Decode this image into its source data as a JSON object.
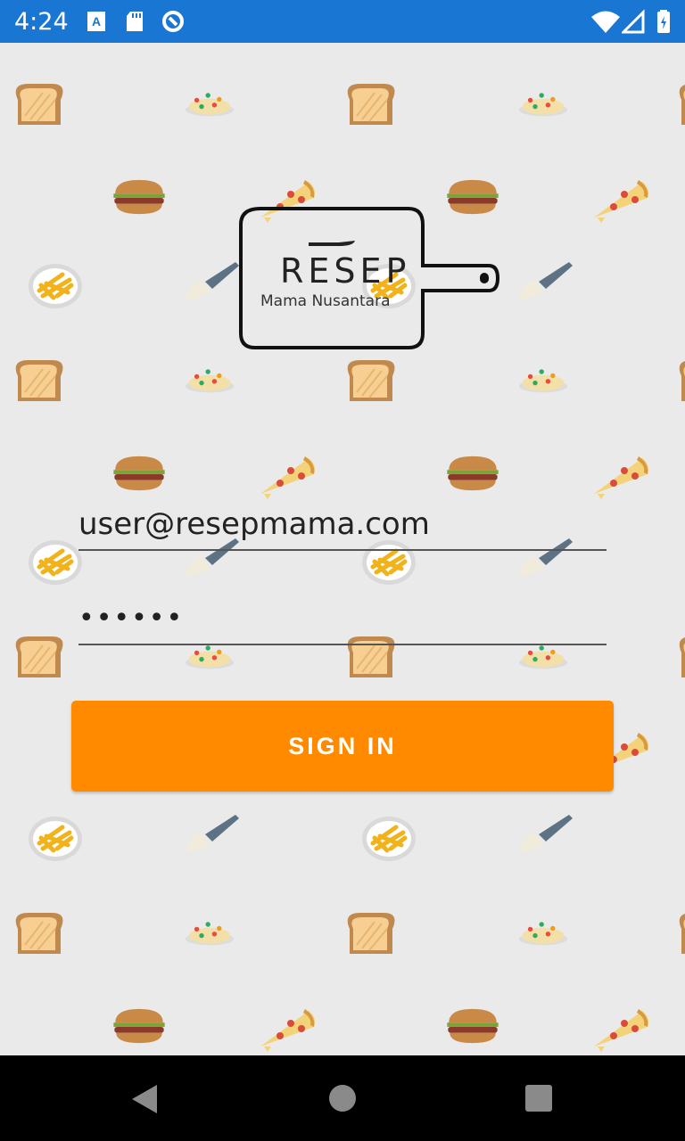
{
  "status_bar": {
    "time": "4:24"
  },
  "logo": {
    "title": "RESEP",
    "subtitle": "Mama Nusantara"
  },
  "form": {
    "email_value": "user@resepmama.com",
    "password_value": "••••••",
    "signin_label": "SIGN IN"
  },
  "colors": {
    "status_bar": "#1976d2",
    "accent": "#ff8a00",
    "background": "#eaeaea"
  }
}
